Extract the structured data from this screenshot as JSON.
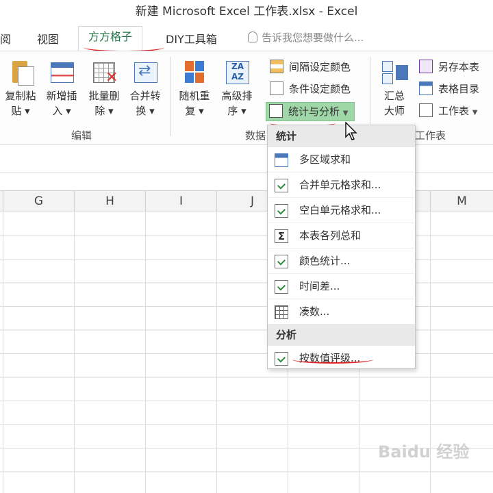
{
  "window": {
    "title": "新建 Microsoft Excel 工作表.xlsx - Excel"
  },
  "tabs": {
    "partial": "阅",
    "view": "视图",
    "active": "方方格子",
    "diy": "DIY工具箱"
  },
  "tell_me": {
    "placeholder": "告诉我您想要做什么..."
  },
  "ribbon": {
    "edit_group": {
      "label": "编辑",
      "buttons": [
        {
          "label": "复制粘\n贴 ▾"
        },
        {
          "label": "新增插\n入 ▾"
        },
        {
          "label": "批量删\n除 ▾"
        },
        {
          "label": "合并转\n换 ▾"
        }
      ]
    },
    "data_group": {
      "label": "数据",
      "buttons": [
        {
          "label": "随机重\n复 ▾"
        },
        {
          "label": "高级排\n序 ▾"
        }
      ],
      "small": [
        {
          "label": "间隔设定颜色"
        },
        {
          "label": "条件设定颜色"
        },
        {
          "label": "统计与分析"
        }
      ]
    },
    "sheet_group": {
      "label": "工作表",
      "big": {
        "label": "汇总\n大师"
      },
      "small": [
        {
          "label": "另存本表"
        },
        {
          "label": "表格目录"
        },
        {
          "label": "工作表"
        }
      ]
    }
  },
  "columns": [
    "G",
    "H",
    "I",
    "J",
    "M"
  ],
  "menu": {
    "section_stats": "统计",
    "stats_items": [
      {
        "label": "多区域求和",
        "icon": "table-icon"
      },
      {
        "label": "合并单元格求和...",
        "icon": "check-doc-icon"
      },
      {
        "label": "空白单元格求和...",
        "icon": "check-doc-icon"
      },
      {
        "label": "本表各列总和",
        "icon": "sigma-icon"
      },
      {
        "label": "颜色统计...",
        "icon": "check-doc-icon"
      },
      {
        "label": "时间差...",
        "icon": "check-doc-icon"
      },
      {
        "label": "凑数...",
        "icon": "grid-icon"
      }
    ],
    "section_analysis": "分析",
    "analysis_items": [
      {
        "label": "按数值评级...",
        "icon": "check-doc-icon"
      }
    ]
  },
  "watermark": "Baidu 经验",
  "colors": {
    "accent_green": "#217346",
    "highlight": "#9fd7a8",
    "annotation_red": "#e02424"
  }
}
